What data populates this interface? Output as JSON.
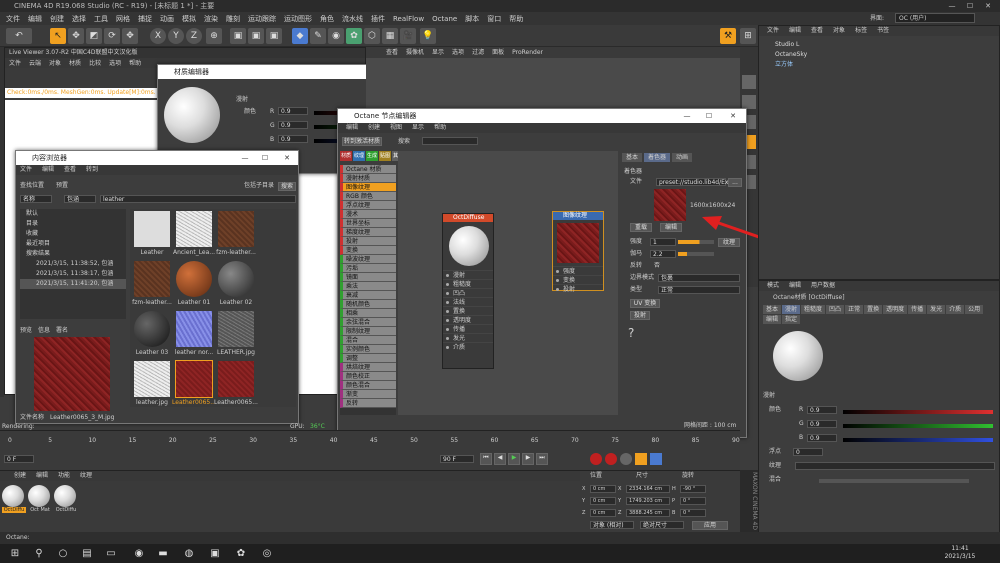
{
  "app_title": "CINEMA 4D R19.068 Studio (RC - R19) - [未标题 1 *] - 主要",
  "menubar": [
    "文件",
    "编辑",
    "创建",
    "选择",
    "工具",
    "网格",
    "捕捉",
    "动画",
    "模拟",
    "渲染",
    "雕刻",
    "运动跟踪",
    "运动图形",
    "角色",
    "流水线",
    "插件",
    "RealFlow",
    "Octane",
    "脚本",
    "窗口",
    "帮助"
  ],
  "layout_label": "界面:",
  "layout_value": "OC (用户)",
  "live_viewer": {
    "title": "Live Viewer 3.07-R2 中国C4D联盟中文汉化版",
    "menu": [
      "文件",
      "云端",
      "对象",
      "材质",
      "比较",
      "选项",
      "帮助"
    ],
    "status": "Check:0ms./0ms. MeshGen:0ms. Update[M]:0ms. Mesh"
  },
  "mat_editor": {
    "title": "材质编辑器",
    "section": "漫射",
    "color_label": "颜色",
    "r": "0.9",
    "g": "0.9",
    "b": "0.9",
    "r_label": "R",
    "g_label": "G",
    "b_label": "B"
  },
  "viewport_menu": [
    "查看",
    "摄像机",
    "显示",
    "选项",
    "过滤",
    "面板",
    "ProRender"
  ],
  "content_browser": {
    "title": "内容浏览器",
    "menu": [
      "文件",
      "编辑",
      "查看",
      "转到"
    ],
    "search_label": "查找位置",
    "preset_label": "预置",
    "name_label": "名称",
    "filter_label": "包涵",
    "search_value": "leather",
    "subdir_label": "包括子目录",
    "search_button": "搜索",
    "tree": [
      "默认",
      "目录",
      "收藏",
      "最近项目",
      "搜索结果",
      "2021/3/15, 11:38:52, 包涵",
      "2021/3/15, 11:38:17, 包涵",
      "2021/3/15, 11:41:20, 包涵"
    ],
    "thumbs": [
      {
        "label": "Leather",
        "kind": "bag"
      },
      {
        "label": "Ancient_Lea...",
        "kind": "white"
      },
      {
        "label": "fzm-leather...",
        "kind": "brown"
      },
      {
        "label": "fzm-leather...",
        "kind": "brown"
      },
      {
        "label": "Leather 01",
        "kind": "ball-brown"
      },
      {
        "label": "Leather 02",
        "kind": "ball-dark"
      },
      {
        "label": "Leather 03",
        "kind": "ball-black"
      },
      {
        "label": "leather nor...",
        "kind": "blue"
      },
      {
        "label": "LEATHER.jpg",
        "kind": "gray"
      },
      {
        "label": "leather.jpg",
        "kind": "white"
      },
      {
        "label": "Leather0065...",
        "kind": "red",
        "selected": true
      },
      {
        "label": "Leather0065...",
        "kind": "red"
      }
    ],
    "preview_tabs": [
      "预览",
      "信息",
      "署名"
    ],
    "file_label": "文件名称",
    "file_name": "Leather0065_3_M.jpg"
  },
  "node_editor": {
    "title": "Octane 节点编辑器",
    "menu": [
      "编辑",
      "创建",
      "视图",
      "显示",
      "帮助"
    ],
    "button": "转到激活材质",
    "search": "搜索",
    "tags": [
      "材质",
      "纹理",
      "生成",
      "贴图",
      "其他",
      "发光",
      "介质",
      "C4D"
    ],
    "categories_top": [
      "Octane 材质",
      "漫射材质",
      "图像纹理",
      "RGB 颜色",
      "浮点纹理",
      "漫术",
      "世界坐标",
      "梯度纹理",
      "投射",
      "变换"
    ],
    "categories_mid": [
      "噪波纹理",
      "污垢",
      "镜面",
      "乘法",
      "衰减",
      "随机颜色",
      "相乘",
      "余弦混合",
      "限制纹理",
      "混合",
      "实例颜色",
      "调整"
    ],
    "categories_low": [
      "烘焙纹理",
      "颜色校正",
      "颜色混合",
      "渐变",
      "反转"
    ],
    "node_diffuse": {
      "title": "OctDiffuse",
      "ports": [
        "漫射",
        "粗糙度",
        "凹凸",
        "法线",
        "置换",
        "透明度",
        "传播",
        "发光",
        "介质"
      ]
    },
    "node_image": {
      "title": "图像纹理",
      "ports": [
        "强度",
        "变换",
        "投射"
      ]
    },
    "props": {
      "tabs": [
        "基本",
        "着色器",
        "动画"
      ],
      "section": "着色器",
      "file_label": "文件",
      "file_value": "preset://studio.lib4d/Ex",
      "resolution": "1600x1600x24",
      "reload": "重载",
      "edit": "编辑",
      "power_label": "强度",
      "power_value": "1",
      "color_button": "纹理",
      "gamma_label": "伽马",
      "gamma_value": "2.2",
      "invert_label": "反转",
      "invert_value": "否",
      "border_label": "边界模式",
      "border_value": "包裹",
      "type_label": "类型",
      "type_value": "正常",
      "uv_button": "UV 变换",
      "proj_button": "投射",
      "help": "?"
    },
    "zoom": "网格间距 : 100 cm"
  },
  "objects": {
    "tabs": [
      "文件",
      "编辑",
      "查看",
      "对象",
      "标签",
      "书签"
    ],
    "items": [
      "Studio L",
      "OctaneSky",
      "立方体"
    ]
  },
  "attributes": {
    "menu": [
      "模式",
      "编辑",
      "用户数据"
    ],
    "title": "Octane材质 [OctDiffuse]",
    "tabs": [
      "基本",
      "漫射",
      "粗糙度",
      "凹凸",
      "正常",
      "置换",
      "透明度",
      "传播",
      "发光",
      "介质",
      "公用",
      "编辑",
      "指定"
    ],
    "section": "漫射",
    "color_label": "颜色",
    "r_label": "R",
    "g_label": "G",
    "b_label": "B",
    "r": "0.9",
    "g": "0.9",
    "b": "0.9",
    "float_label": "浮点",
    "float_value": "0",
    "tex_label": "纹理",
    "mix_label": "混合"
  },
  "timeline": {
    "ticks": [
      "0",
      "5",
      "10",
      "15",
      "20",
      "25",
      "30",
      "35",
      "40",
      "45",
      "50",
      "55",
      "60",
      "65",
      "70",
      "75",
      "80",
      "85",
      "90"
    ],
    "start": "0 F",
    "end": "90 F",
    "frame": "0 F"
  },
  "materials": {
    "menu": [
      "创建",
      "编辑",
      "功能",
      "纹理"
    ],
    "items": [
      "OctDiffu",
      "Oct Mat",
      "OctDiffu"
    ]
  },
  "coords": {
    "headers": [
      "位置",
      "尺寸",
      "旋转"
    ],
    "rows": [
      [
        "X",
        "0 cm",
        "X",
        "2334.164 cm",
        "H",
        "-90 °"
      ],
      [
        "Y",
        "0 cm",
        "Y",
        "1749.203 cm",
        "P",
        "0 °"
      ],
      [
        "Z",
        "0 cm",
        "Z",
        "3888.245 cm",
        "B",
        "0 °"
      ]
    ],
    "mode1": "对象 (相对)",
    "mode2": "绝对尺寸",
    "apply": "应用"
  },
  "status_text": "Octane:",
  "gpu_label": "GPU:",
  "gpu_value": "36°C",
  "render_label": "Rendering:",
  "taskbar": {
    "time": "11:41",
    "date": "2021/3/15"
  },
  "colors": {
    "accent": "#f0a020",
    "arrow": "#e02020",
    "leather": "#8a2222"
  }
}
